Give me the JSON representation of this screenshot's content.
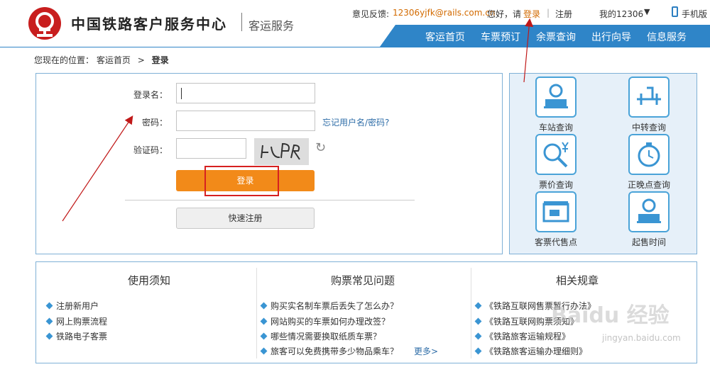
{
  "header": {
    "brand": "中国铁路客户服务中心",
    "sub_brand": "客运服务",
    "feedback_label": "意见反馈:",
    "feedback_email": "12306yjfk@rails.com.cn",
    "greeting": "您好，请",
    "login_link": "登录",
    "separator": "|",
    "register_link": "注册",
    "my_account": "我的12306",
    "dropdown_arrow": "▼",
    "mobile": "手机版"
  },
  "nav": {
    "items": [
      "客运首页",
      "车票预订",
      "余票查询",
      "出行向导",
      "信息服务"
    ]
  },
  "breadcrumb": {
    "prefix": "您现在的位置：",
    "home": "客运首页",
    "arrow": ">",
    "current": "登录"
  },
  "login": {
    "username_label": "登录名：",
    "password_label": "密码：",
    "captcha_label": "验证码：",
    "forgot_link": "忘记用户名/密码?",
    "captcha_text": "4LPR",
    "refresh_icon": "↻",
    "login_button": "登录",
    "register_button": "快速注册"
  },
  "quick_links": [
    {
      "label": "车站查询",
      "icon": "station-icon"
    },
    {
      "label": "中转查询",
      "icon": "transfer-icon"
    },
    {
      "label": "票价查询",
      "icon": "price-search-icon"
    },
    {
      "label": "正晚点查询",
      "icon": "clock-icon"
    },
    {
      "label": "客票代售点",
      "icon": "ticket-agency-icon"
    },
    {
      "label": "起售时间",
      "icon": "sale-time-icon"
    }
  ],
  "info": {
    "col1": {
      "title": "使用须知",
      "items": [
        "注册新用户",
        "网上购票流程",
        "铁路电子客票"
      ]
    },
    "col2": {
      "title": "购票常见问题",
      "items": [
        "购买实名制车票后丢失了怎么办？",
        "网站购买的车票如何办理改签？",
        "哪些情况需要换取纸质车票？",
        "旅客可以免费携带多少物品乘车？"
      ],
      "more": "更多>"
    },
    "col3": {
      "title": "相关规章",
      "items": [
        "《铁路互联网售票暂行办法》",
        "《铁路互联网购票须知》",
        "《铁路旅客运输规程》",
        "《铁路旅客运输办理细则》"
      ]
    }
  },
  "watermark": {
    "text": "Baidu 经验",
    "url": "jingyan.baidu.com"
  },
  "colors": {
    "nav_blue": "#2f85c8",
    "login_orange": "#f28a19",
    "link_orange": "#d26a00",
    "annotation_red": "#d62020"
  }
}
